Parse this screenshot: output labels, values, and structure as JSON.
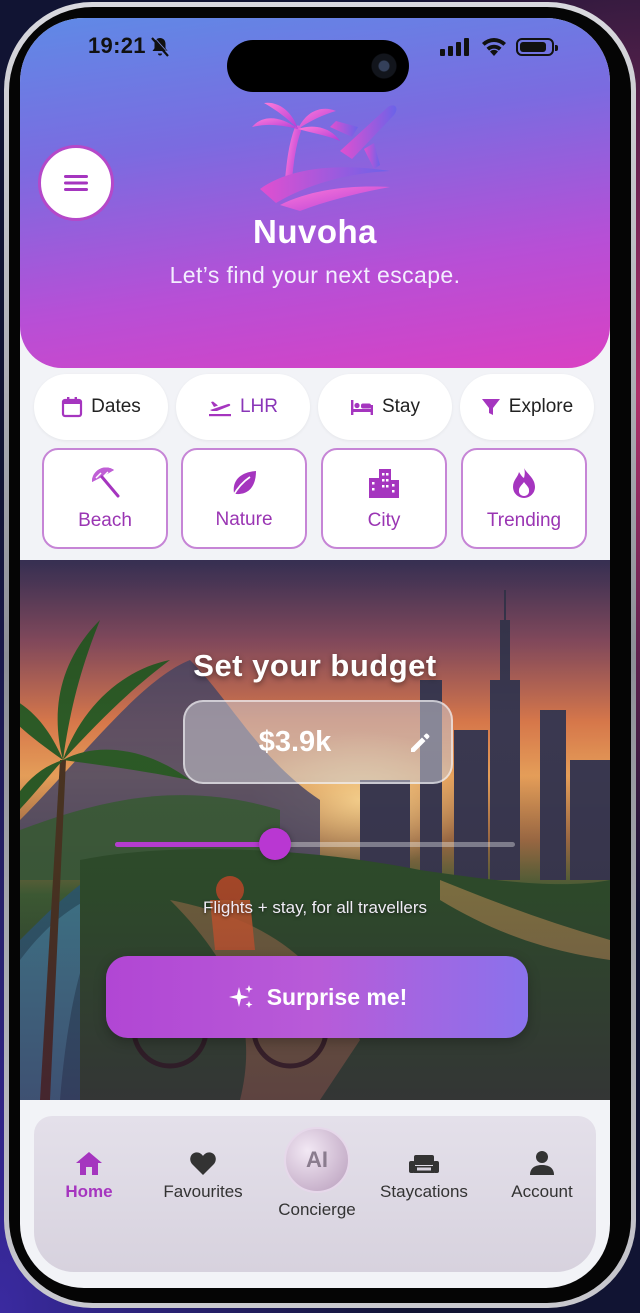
{
  "status_bar": {
    "time": "19:21"
  },
  "header": {
    "brand": "Nuvoha",
    "tagline": "Let’s find your next escape."
  },
  "chips": [
    {
      "label": "Dates",
      "icon": "calendar-icon"
    },
    {
      "label": "LHR",
      "icon": "flight-departure-icon"
    },
    {
      "label": "Stay",
      "icon": "bed-icon"
    },
    {
      "label": "Explore",
      "icon": "filter-icon"
    }
  ],
  "categories": [
    {
      "label": "Beach",
      "icon": "beach-umbrella-icon"
    },
    {
      "label": "Nature",
      "icon": "leaf-icon"
    },
    {
      "label": "City",
      "icon": "city-buildings-icon"
    },
    {
      "label": "Trending",
      "icon": "flame-icon"
    }
  ],
  "budget": {
    "title": "Set your budget",
    "value": "$3.9k",
    "slider_fraction": 0.4,
    "note": "Flights + stay, for all travellers",
    "button_label": "Surprise me!"
  },
  "nav": {
    "home": "Home",
    "favourites": "Favourites",
    "ai_badge": "AI",
    "concierge": "Concierge",
    "staycations": "Staycations",
    "account": "Account"
  },
  "colors": {
    "accent": "#a535bf",
    "hero_start": "#5f8ae6",
    "hero_end": "#d941c3"
  }
}
